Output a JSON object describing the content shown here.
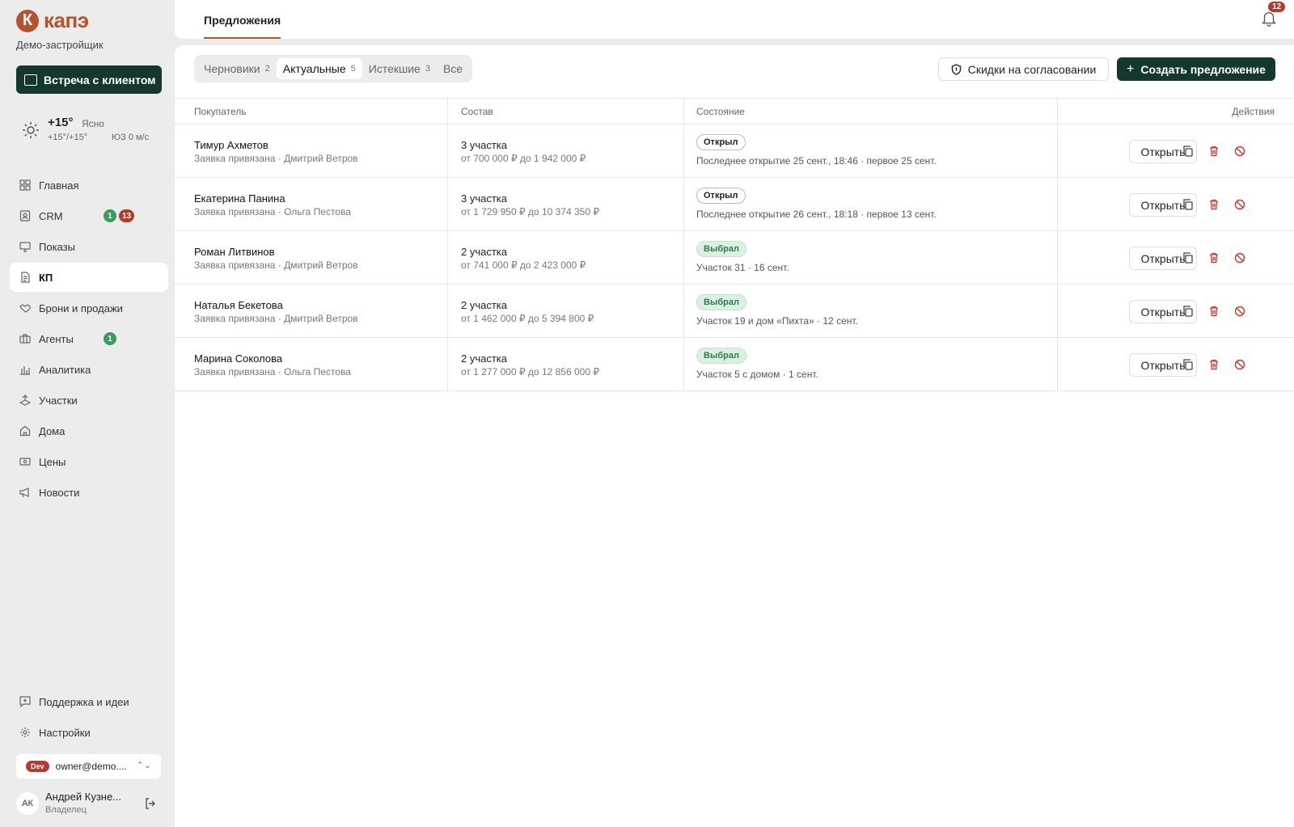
{
  "brand": {
    "name": "капэ",
    "mark": "К",
    "company": "Демо-застройщик"
  },
  "sidebar": {
    "meet_label": "Встреча с клиентом",
    "weather": {
      "temp": "+15°",
      "desc": "Ясно",
      "range": "+15°/+15°",
      "wind": "ЮЗ 0 м/с"
    },
    "items": [
      {
        "label": "Главная",
        "icon": "grid-icon"
      },
      {
        "label": "CRM",
        "icon": "contact-icon",
        "badges": [
          "1",
          "13"
        ]
      },
      {
        "label": "Показы",
        "icon": "monitor-icon"
      },
      {
        "label": "КП",
        "icon": "document-icon",
        "active": true
      },
      {
        "label": "Брони и продажи",
        "icon": "handshake-icon"
      },
      {
        "label": "Агенты",
        "icon": "briefcase-icon",
        "badges": [
          "1"
        ]
      },
      {
        "label": "Аналитика",
        "icon": "bar-chart-icon"
      },
      {
        "label": "Участки",
        "icon": "land-icon"
      },
      {
        "label": "Дома",
        "icon": "house-icon"
      },
      {
        "label": "Цены",
        "icon": "price-tag-icon"
      },
      {
        "label": "Новости",
        "icon": "megaphone-icon"
      }
    ],
    "bottom_items": [
      {
        "label": "Поддержка и идеи",
        "icon": "message-plus-icon"
      },
      {
        "label": "Настройки",
        "icon": "gear-icon"
      }
    ],
    "account": {
      "env": "Dev",
      "email": "owner@demo...."
    },
    "profile": {
      "initials": "АК",
      "name": "Андрей Кузне...",
      "role": "Владелец"
    }
  },
  "header": {
    "tab": "Предложения",
    "notifications": "12"
  },
  "filters": {
    "tabs": [
      {
        "label": "Черновики",
        "count": "2"
      },
      {
        "label": "Актуальные",
        "count": "5",
        "active": true
      },
      {
        "label": "Истекшие",
        "count": "3"
      },
      {
        "label": "Все",
        "count": ""
      }
    ],
    "discount_label": "Скидки на согласовании",
    "create_label": "Создать предложение"
  },
  "table": {
    "columns": [
      "Покупатель",
      "Состав",
      "Состояние",
      "Действия"
    ],
    "open_label": "Открыть",
    "rows": [
      {
        "buyer": "Тимур Ахметов",
        "buyer_sub": "Заявка привязана · Дмитрий Ветров",
        "composition": "3 участка",
        "price": "от 700 000 ₽ до 1 942 000 ₽",
        "status": "Открыл",
        "status_kind": "open",
        "detail": "Последнее открытие 25 сент., 18:46 · первое 25 сент."
      },
      {
        "buyer": "Екатерина Панина",
        "buyer_sub": "Заявка привязана · Ольга Пестова",
        "composition": "3 участка",
        "price": "от 1 729 950 ₽ до 10 374 350 ₽",
        "status": "Открыл",
        "status_kind": "open",
        "detail": "Последнее открытие 26 сент., 18:18 · первое 13 сент."
      },
      {
        "buyer": "Роман Литвинов",
        "buyer_sub": "Заявка привязана · Дмитрий Ветров",
        "composition": "2 участка",
        "price": "от 741 000 ₽ до 2 423 000 ₽",
        "status": "Выбрал",
        "status_kind": "chosen",
        "detail": "Участок 31 · 16 сент."
      },
      {
        "buyer": "Наталья Бекетова",
        "buyer_sub": "Заявка привязана · Дмитрий Ветров",
        "composition": "2 участка",
        "price": "от 1 462 000 ₽ до 5 394 800 ₽",
        "status": "Выбрал",
        "status_kind": "chosen",
        "detail": "Участок 19 и дом «Пихта» · 12 сент."
      },
      {
        "buyer": "Марина Соколова",
        "buyer_sub": "Заявка привязана · Ольга Пестова",
        "composition": "2 участка",
        "price": "от 1 277 000 ₽ до 12 856 000 ₽",
        "status": "Выбрал",
        "status_kind": "chosen",
        "detail": "Участок 5 с домом · 1 сент."
      }
    ]
  },
  "colors": {
    "accent": "#b3532f",
    "primary": "#14382f",
    "danger": "#b23a2e",
    "success": "#3a9b5c"
  }
}
